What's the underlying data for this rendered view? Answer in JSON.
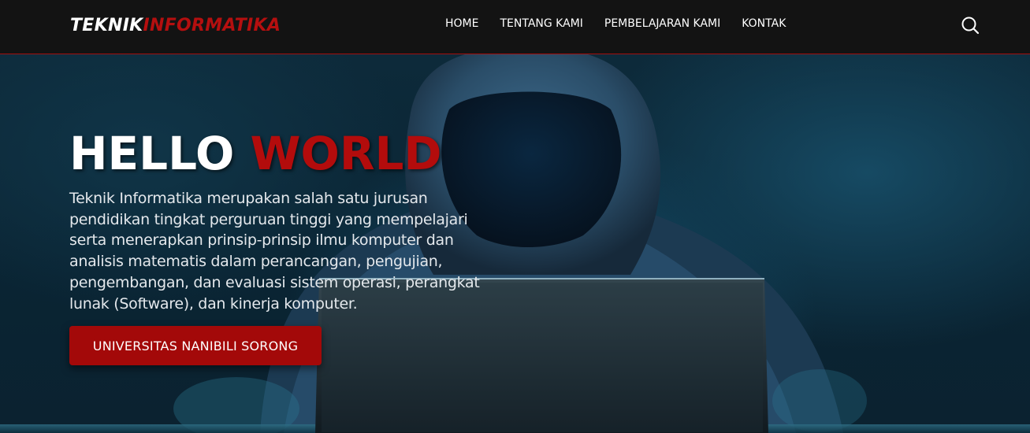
{
  "header": {
    "brand_part1": "TEKNIK",
    "brand_part2": "INFORMATIKA",
    "nav": [
      "HOME",
      "TENTANG KAMI",
      "PEMBELAJARAN KAMI",
      "KONTAK"
    ],
    "search_icon": "search-icon"
  },
  "hero": {
    "title_part1": "HELLO",
    "title_part2": "WORLD",
    "description": "Teknik Informatika merupakan salah satu jurusan pendidikan tingkat perguruan tinggi yang mempelajari serta menerapkan prinsip-prinsip ilmu komputer dan analisis matematis dalam perancangan, pengujian, pengembangan, dan evaluasi sistem operasi, perangkat lunak (Software), dan kinerja komputer.",
    "button_label": "UNIVERSITAS NANIBILI SORONG"
  },
  "colors": {
    "accent": "#b30c0c",
    "navbar": "#131313",
    "button": "#a30909"
  }
}
